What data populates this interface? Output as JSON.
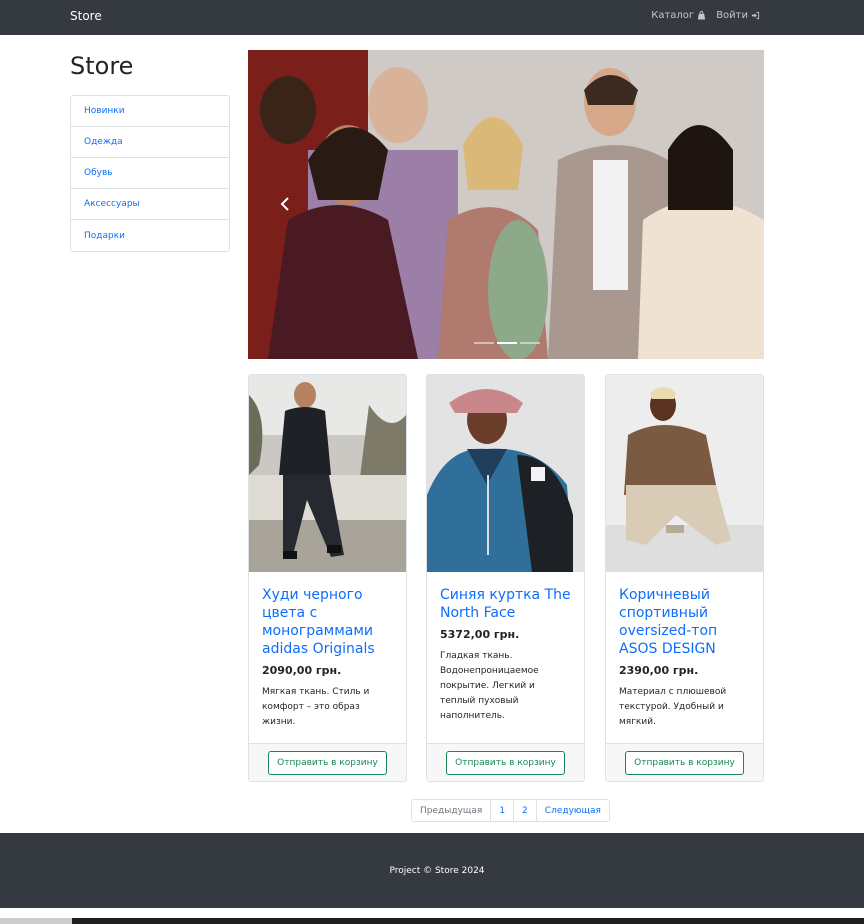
{
  "navbar": {
    "brand": "Store",
    "catalog_label": "Каталог",
    "login_label": "Войти",
    "catalog_icon": "shopping-bag-icon",
    "login_icon": "sign-in-icon",
    "background": "#343a40"
  },
  "sidebar": {
    "title": "Store",
    "items": [
      {
        "label": "Новинки"
      },
      {
        "label": "Одежда"
      },
      {
        "label": "Обувь"
      },
      {
        "label": "Аксессуары"
      },
      {
        "label": "Подарки"
      }
    ]
  },
  "carousel": {
    "prev_icon": "chevron-left-icon",
    "slide_count": 3,
    "active_index": 1
  },
  "products": [
    {
      "title": "Худи черного цвета с монограммами adidas Originals",
      "price": "2090,00 грн.",
      "description": "Мягкая ткань. Стиль и комфорт – это образ жизни.",
      "button": "Отправить в корзину"
    },
    {
      "title": "Синяя куртка The North Face",
      "price": "5372,00 грн.",
      "description": "Гладкая ткань. Водонепроницаемое покрытие. Легкий и теплый пуховый наполнитель.",
      "button": "Отправить в корзину"
    },
    {
      "title": "Коричневый спортивный oversized-топ ASOS DESIGN",
      "price": "2390,00 грн.",
      "description": "Материал с плюшевой текстурой. Удобный и мягкий.",
      "button": "Отправить в корзину"
    }
  ],
  "pagination": {
    "prev": "Предыдущая",
    "pages": [
      "1",
      "2"
    ],
    "next": "Следующая"
  },
  "footer": {
    "text": "Project © Store 2024"
  },
  "colors": {
    "link": "#0d6efd",
    "success": "#198754",
    "dark": "#343a40"
  }
}
